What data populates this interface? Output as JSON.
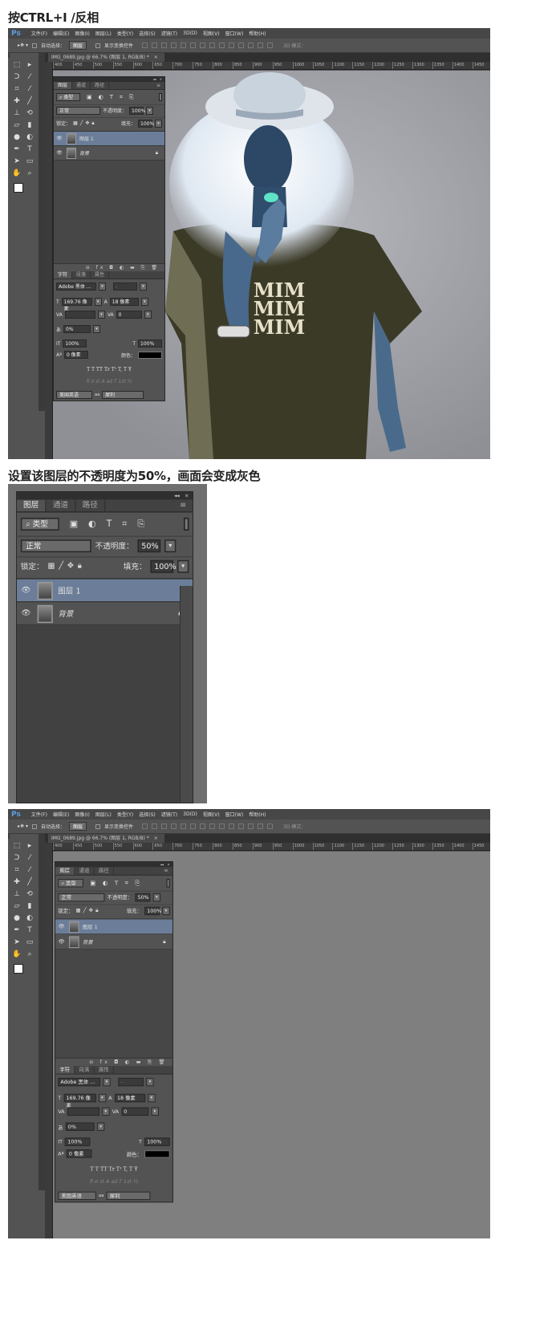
{
  "section1_title": "按CTRL+I /反相",
  "section2_title": "设置该图层的不透明度为50%，画面会变成灰色",
  "app": {
    "logo": "Ps",
    "menu": [
      "文件(F)",
      "编辑(E)",
      "图像(I)",
      "图层(L)",
      "类型(Y)",
      "选择(S)",
      "滤镜(T)",
      "3D(D)",
      "视图(V)",
      "窗口(W)",
      "帮助(H)"
    ],
    "options": {
      "auto_select": "自动选择：",
      "auto_select_target": "图层",
      "show_transform": "显示变换控件",
      "mode_3d": "3D 模式："
    },
    "document_tab": "IMG_0689.jpg @ 66.7% (图层 1, RGB/8) *",
    "close": "×",
    "collapse": "◂◂",
    "ruler_ticks": [
      "400",
      "450",
      "500",
      "550",
      "600",
      "650",
      "700",
      "750",
      "800",
      "850",
      "900",
      "950",
      "1000",
      "1050",
      "1100",
      "1150",
      "1200",
      "1250",
      "1300",
      "1350",
      "1400",
      "1450",
      "1500",
      "1550",
      "1600",
      "1650",
      "1700",
      "1750"
    ],
    "tools": [
      "marquee",
      "move",
      "lasso",
      "magic-wand",
      "crop",
      "eyedropper",
      "healing",
      "brush",
      "stamp",
      "history-brush",
      "eraser",
      "gradient",
      "blur",
      "dodge",
      "pen",
      "type",
      "path-select",
      "rectangle",
      "hand",
      "zoom"
    ]
  },
  "layers_panel": {
    "tabs": [
      "图层",
      "通道",
      "路径"
    ],
    "menu_icon": "≡",
    "filter": "类型",
    "blend_mode": "正常",
    "opacity_label": "不透明度：",
    "lock_label": "锁定：",
    "fill_label": "填充：",
    "fill": "100%",
    "layers": [
      {
        "name": "图层 1",
        "selected": true
      },
      {
        "name": "背景",
        "locked": true
      }
    ]
  },
  "character_panel": {
    "tabs": [
      "字符",
      "段落",
      "属性"
    ],
    "font_family": "Adobe 黑体 ...",
    "font_style": "-",
    "size": "169.76 像素",
    "leading": "18 像素",
    "kerning": "",
    "tracking": "0",
    "tsume": "0%",
    "vertical_scale": "100%",
    "horizontal_scale": "100%",
    "baseline_shift": "0 像素",
    "color_label": "颜色：",
    "type_styles": "T  T  TT  Tr  T¹  T,  T  Ŧ",
    "opentype": "fi  σ  st  A  ad  T  1st  ½",
    "language": "美国英语",
    "aa_label": "aa",
    "antialias": "犀利"
  },
  "screens": [
    {
      "opacity": "100%",
      "canvas_color": "#9fa1a7"
    },
    {
      "opacity": "50%"
    },
    {
      "opacity": "50%",
      "canvas_color": "#7f7f7f"
    }
  ],
  "photo_text": [
    "MIM",
    "MIM",
    "MIM"
  ],
  "colors": {
    "selected_layer": "#6b7d98",
    "ui_bg": "#535353",
    "logo": "#5aa0e0"
  }
}
